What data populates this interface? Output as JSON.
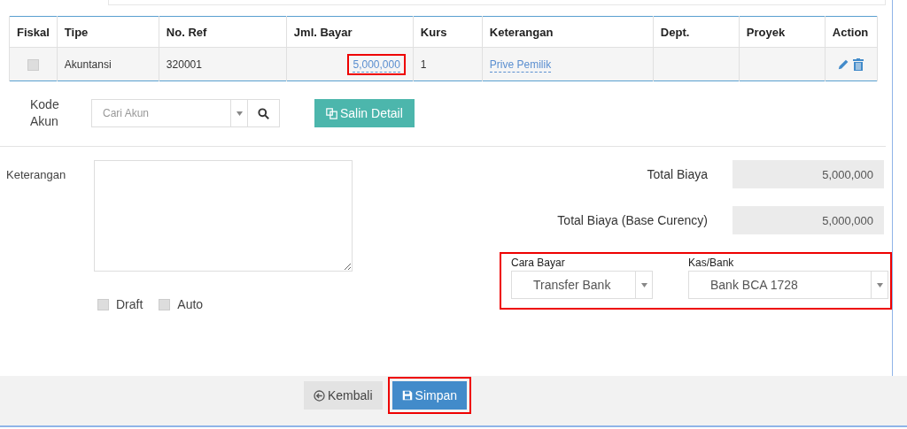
{
  "table": {
    "columns": [
      "Fiskal",
      "Tipe",
      "No. Ref",
      "Jml. Bayar",
      "Kurs",
      "Keterangan",
      "Dept.",
      "Proyek",
      "Action"
    ],
    "rows": [
      {
        "fiskal_checked": false,
        "tipe": "Akuntansi",
        "no_ref": "320001",
        "jml_bayar": "5,000,000",
        "jml_bayar_highlighted": true,
        "kurs": "1",
        "keterangan": "Prive Pemilik"
      }
    ]
  },
  "kode_akun": {
    "label": "Kode Akun",
    "placeholder": "Cari Akun"
  },
  "copy_button": {
    "label": "Salin Detail"
  },
  "keterangan": {
    "label": "Keterangan"
  },
  "options": [
    {
      "label": "Draft",
      "checked": false
    },
    {
      "label": "Auto",
      "checked": false
    }
  ],
  "totals": [
    {
      "label": "Total Biaya",
      "value": "5,000,000"
    },
    {
      "label": "Total Biaya (Base Curency)",
      "value": "5,000,000"
    }
  ],
  "payment": {
    "highlighted": true,
    "fields": [
      {
        "label": "Cara Bayar",
        "value": "Transfer Bank"
      },
      {
        "label": "Kas/Bank",
        "value": "Bank BCA 1728"
      }
    ]
  },
  "buttons": [
    {
      "label": "Kembali",
      "kind": "back",
      "highlighted": false
    },
    {
      "label": "Simpan",
      "kind": "save",
      "highlighted": true
    }
  ]
}
